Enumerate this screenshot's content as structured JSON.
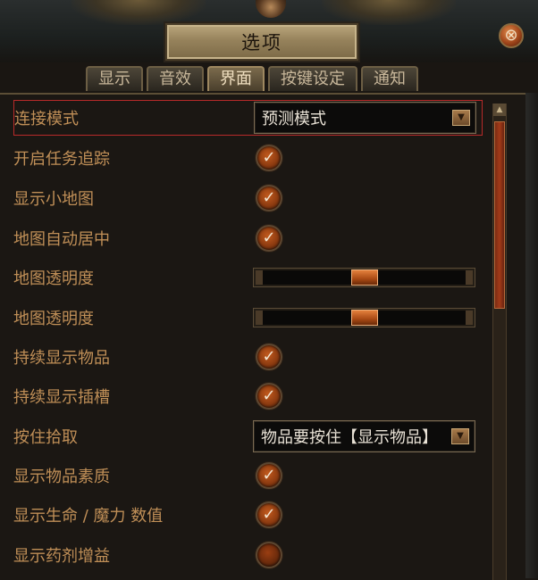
{
  "window": {
    "title": "选项",
    "close_label": "⊗"
  },
  "tabs": [
    {
      "label": "显示",
      "active": false
    },
    {
      "label": "音效",
      "active": false
    },
    {
      "label": "界面",
      "active": true
    },
    {
      "label": "按键设定",
      "active": false
    },
    {
      "label": "通知",
      "active": false
    }
  ],
  "settings": [
    {
      "label": "连接模式",
      "control": "dropdown",
      "value": "预测模式",
      "highlighted": true
    },
    {
      "label": "开启任务追踪",
      "control": "checkbox",
      "checked": true
    },
    {
      "label": "显示小地图",
      "control": "checkbox",
      "checked": true
    },
    {
      "label": "地图自动居中",
      "control": "checkbox",
      "checked": true
    },
    {
      "label": "地图透明度",
      "control": "slider",
      "value_fraction": 0.5
    },
    {
      "label": "地图透明度",
      "control": "slider",
      "value_fraction": 0.5
    },
    {
      "label": "持续显示物品",
      "control": "checkbox",
      "checked": true
    },
    {
      "label": "持续显示插槽",
      "control": "checkbox",
      "checked": true
    },
    {
      "label": "按住拾取",
      "control": "dropdown",
      "value": "物品要按住【显示物品】"
    },
    {
      "label": "显示物品素质",
      "control": "checkbox",
      "checked": true
    },
    {
      "label": "显示生命 / 魔力 数值",
      "control": "checkbox",
      "checked": true
    },
    {
      "label": "显示药剂增益",
      "control": "checkbox",
      "checked": false
    }
  ],
  "icons": {
    "check": "✓",
    "dropdown_arrow": "▼",
    "scroll_up": "▲"
  },
  "colors": {
    "label_text": "#c08f57",
    "highlight_border": "#b82a2a",
    "checkbox_orange": "#c25a1d"
  }
}
